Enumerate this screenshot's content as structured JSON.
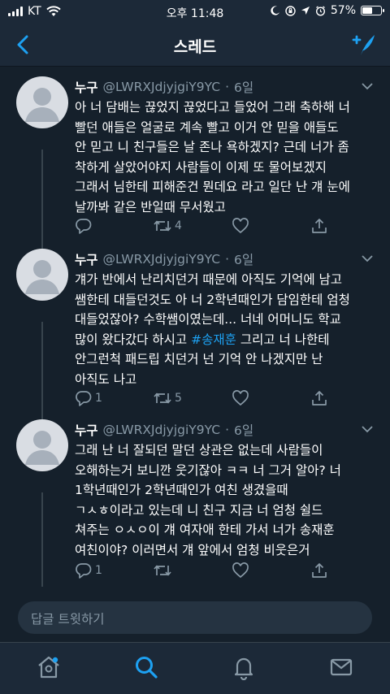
{
  "status": {
    "carrier": "KT",
    "time": "오후 11:48",
    "battery": "57%",
    "battery_level": 0.57
  },
  "header": {
    "title": "스레드"
  },
  "tweets": [
    {
      "name": "누구",
      "handle": "@LWRXJdjyjgiY9YC",
      "dot": "·",
      "time": "6일",
      "text": "아 너 담배는 끊었지 끊었다고 들었어 그래 축하해 너\n빨던 애들은 얼굴로 계속 빨고 이거 안 믿을 애들도\n안 믿고 니 친구들은 날 존나 욕하겠지? 근데 너가 좀\n착하게 살았어야지 사람들이 이제 또 물어보겠지\n그래서 님한테 피해준건 뭔데요 라고 일단 난 걔 눈에\n날까봐 같은 반일때 무서웠고",
      "reply_count": "",
      "retweet_count": "4"
    },
    {
      "name": "누구",
      "handle": "@LWRXJdjyjgiY9YC",
      "dot": "·",
      "time": "6일",
      "text_before": "걔가 반에서 난리치던거 때문에 아직도 기억에 남고\n쌤한테 대들던것도 아 너 2학년때인가 담임한테 엄청\n대들었잖아? 수학쌤이였는데... 너네 어머니도 학교\n많이 왔다갔다 하시고 ",
      "hashtag": "#송재훈",
      "text_after": " 그리고 너 나한테\n안그런척 패드립 치던거 넌 기억 안 나겠지만 난\n아직도 나고",
      "reply_count": "1",
      "retweet_count": "5"
    },
    {
      "name": "누구",
      "handle": "@LWRXJdjyjgiY9YC",
      "dot": "·",
      "time": "6일",
      "text": "그래 난 너 잘되던 말던 상관은 없는데 사람들이\n오해하는거 보니깐 웃기잖아 ㅋㅋ 너 그거 알아? 너\n1학년때인가 2학년때인가 여친 생겼을때\nㄱㅅㅎ이라고 있는데 니 친구 지금 너 엄청 쉴드\n쳐주는 ㅇㅅㅇ이 걔 여자애 한테 가서 너가 송재훈\n여친이야? 이러면서 걔 앞에서 엄청 비웃은거",
      "reply_count": "1",
      "retweet_count": ""
    }
  ],
  "reply_box": {
    "placeholder": "답글 트윗하기"
  },
  "colors": {
    "background": "#15202b",
    "bar": "#1c2938",
    "accent": "#1da1f2",
    "muted": "#8899a6"
  },
  "icons": [
    "back-arrow-icon",
    "compose-icon",
    "chevron-down-icon",
    "reply-icon",
    "retweet-icon",
    "like-icon",
    "share-icon",
    "home-icon",
    "search-icon",
    "notifications-icon",
    "messages-icon"
  ]
}
